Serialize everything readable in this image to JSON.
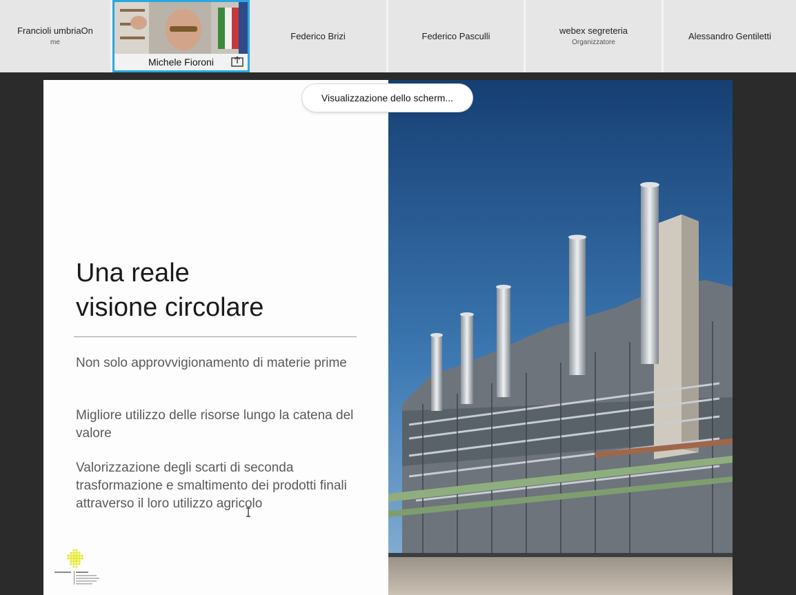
{
  "participants": [
    {
      "name": "Francioli umbriaOn",
      "role": "me"
    },
    {
      "name": "Michele Fioroni",
      "role": ""
    },
    {
      "name": "Federico Brizi",
      "role": ""
    },
    {
      "name": "Federico Pasculli",
      "role": ""
    },
    {
      "name": "webex segreteria",
      "role": "Organizzatore"
    },
    {
      "name": "Alessandro Gentiletti",
      "role": ""
    }
  ],
  "toast": {
    "label": "Visualizzazione dello scherm..."
  },
  "slide": {
    "title_line1": "Una reale",
    "title_line2": "visione circolare",
    "bullets": [
      "Non solo approvvigionamento di materie prime",
      "Migliore utilizzo delle risorse lungo la catena del valore",
      "Valorizzazione degli scarti di seconda trasformazione e smaltimento dei prodotti finali attraverso il loro utilizzo agricolo"
    ]
  },
  "icons": {
    "share": "share-screen-icon",
    "cursor": "text-cursor-icon"
  },
  "colors": {
    "active_speaker_border": "#29a8e0",
    "strip_bg": "#e6e6e6",
    "stage_bg": "#2b2b2b"
  }
}
